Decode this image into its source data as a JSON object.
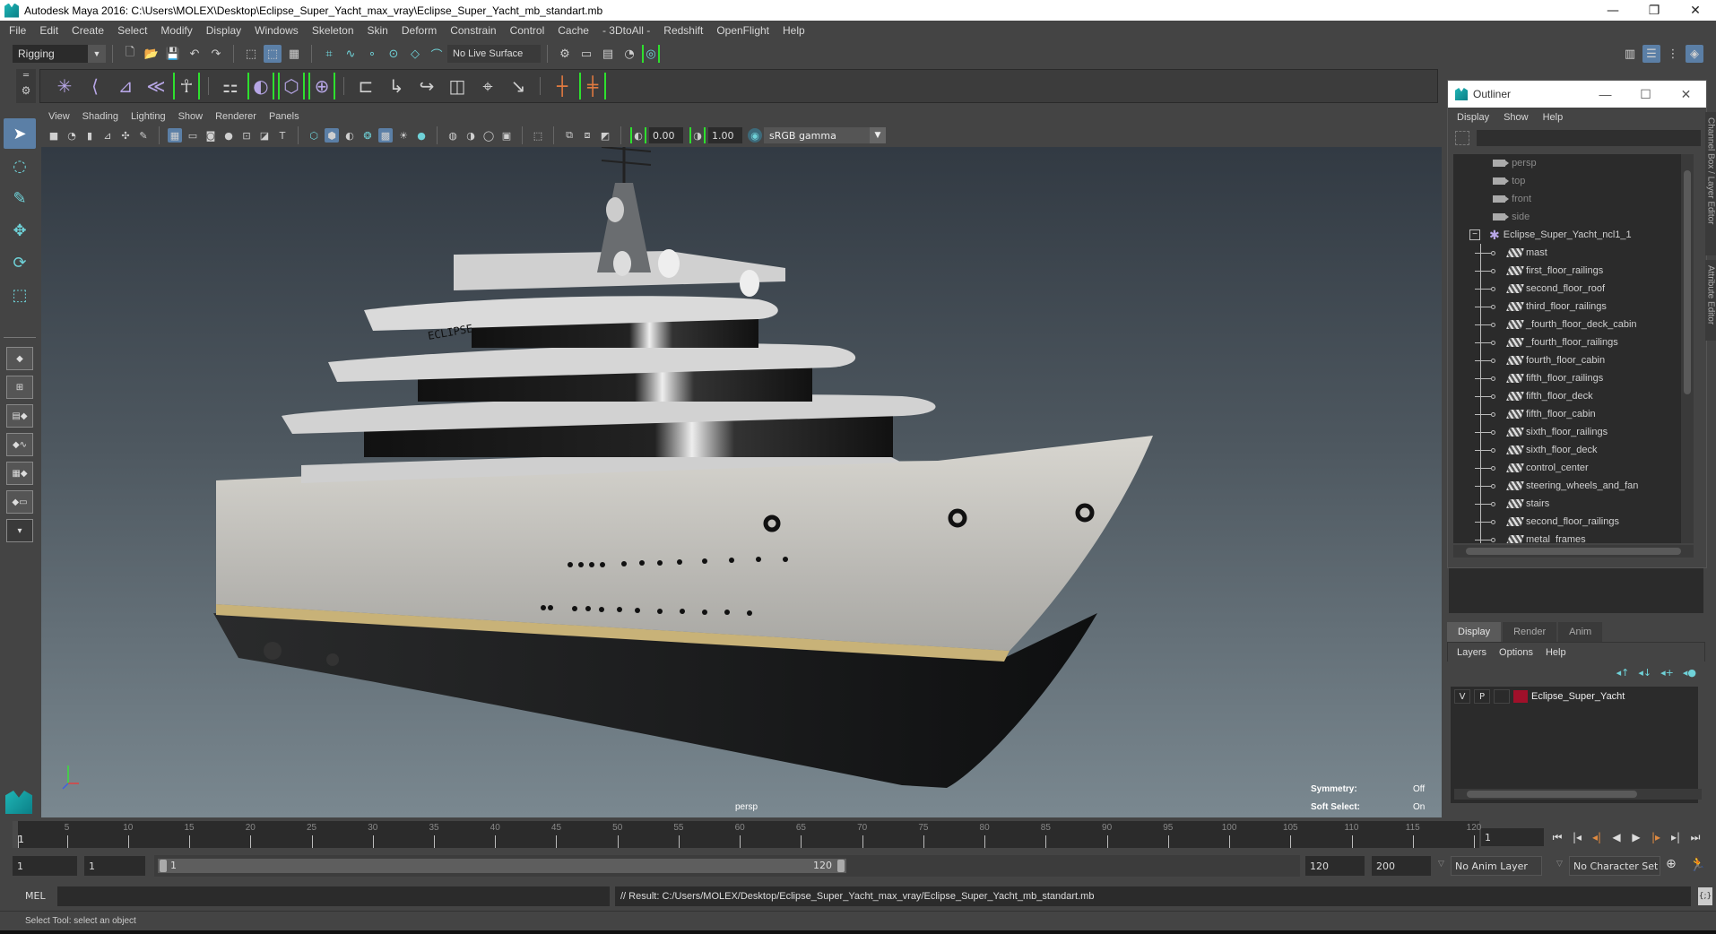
{
  "window": {
    "title": "Autodesk Maya 2016: C:\\Users\\MOLEX\\Desktop\\Eclipse_Super_Yacht_max_vray\\Eclipse_Super_Yacht_mb_standart.mb",
    "controls": {
      "minimize": "—",
      "restore": "❐",
      "close": "✕"
    }
  },
  "menubar": [
    "File",
    "Edit",
    "Create",
    "Select",
    "Modify",
    "Display",
    "Windows",
    "Skeleton",
    "Skin",
    "Deform",
    "Constrain",
    "Control",
    "Cache",
    "- 3DtoAll -",
    "Redshift",
    "OpenFlight",
    "Help"
  ],
  "statusline": {
    "mode": "Rigging",
    "live_surface": "No Live Surface"
  },
  "viewport_panel": {
    "menu": [
      "View",
      "Shading",
      "Lighting",
      "Show",
      "Renderer",
      "Panels"
    ],
    "exposure": "0.00",
    "gamma": "1.00",
    "color_space": "sRGB gamma",
    "camera_label": "persp",
    "hud": {
      "symmetry_label": "Symmetry:",
      "symmetry_value": "Off",
      "soft_select_label": "Soft Select:",
      "soft_select_value": "On"
    },
    "model_label": "ECLIPSE",
    "axis": {
      "y": "y",
      "x": "x",
      "z": "z"
    }
  },
  "outliner": {
    "title": "Outliner",
    "menu": [
      "Display",
      "Show",
      "Help"
    ],
    "search_value": "",
    "cameras": [
      "persp",
      "top",
      "front",
      "side"
    ],
    "group": "Eclipse_Super_Yacht_ncl1_1",
    "group_expander": "−",
    "children": [
      "mast",
      "first_floor_railings",
      "second_floor_roof",
      "third_floor_railings",
      "_fourth_floor_deck_cabin",
      "_fourth_floor_railings",
      "fourth_floor_cabin",
      "fifth_floor_railings",
      "fifth_floor_deck",
      "fifth_floor_cabin",
      "sixth_floor_railings",
      "sixth_floor_deck",
      "control_center",
      "steering_wheels_and_fan",
      "stairs",
      "second_floor_railings",
      "metal_frames"
    ]
  },
  "side_tabs": {
    "channel_box": "Channel Box / Layer Editor",
    "attribute_editor": "Attribute Editor"
  },
  "layer_editor": {
    "tabs": [
      "Display",
      "Render",
      "Anim"
    ],
    "active_tab": "Display",
    "menu": [
      "Layers",
      "Options",
      "Help"
    ],
    "layers": [
      {
        "visible": "V",
        "playback": "P",
        "name": "Eclipse_Super_Yacht",
        "color": "#a0102a"
      }
    ]
  },
  "timeslider": {
    "labels": [
      "5",
      "10",
      "15",
      "20",
      "25",
      "30",
      "35",
      "40",
      "45",
      "50",
      "55",
      "60",
      "65",
      "70",
      "75",
      "80",
      "85",
      "90",
      "95",
      "100",
      "105",
      "110",
      "115",
      "120"
    ],
    "start": 1,
    "end": 120,
    "current_frame": "1",
    "current_field": "1"
  },
  "rangeslider": {
    "start_field": "1",
    "playback_start": "1",
    "range_start_label": "1",
    "range_end_label": "120",
    "playback_end": "120",
    "end_field": "200",
    "anim_layer": "No Anim Layer",
    "character_set": "No Character Set"
  },
  "cmdline": {
    "label": "MEL",
    "input_value": "",
    "result": "// Result: C:/Users/MOLEX/Desktop/Eclipse_Super_Yacht_max_vray/Eclipse_Super_Yacht_mb_standart.mb"
  },
  "helpline": "Select Tool: select an object",
  "colors": {
    "accent_blue": "#5b7fa6",
    "shelf_green": "#2ee02e",
    "icon_purple": "#b7a6e6",
    "icon_teal": "#6fd2d8",
    "key_orange": "#e08a40"
  }
}
